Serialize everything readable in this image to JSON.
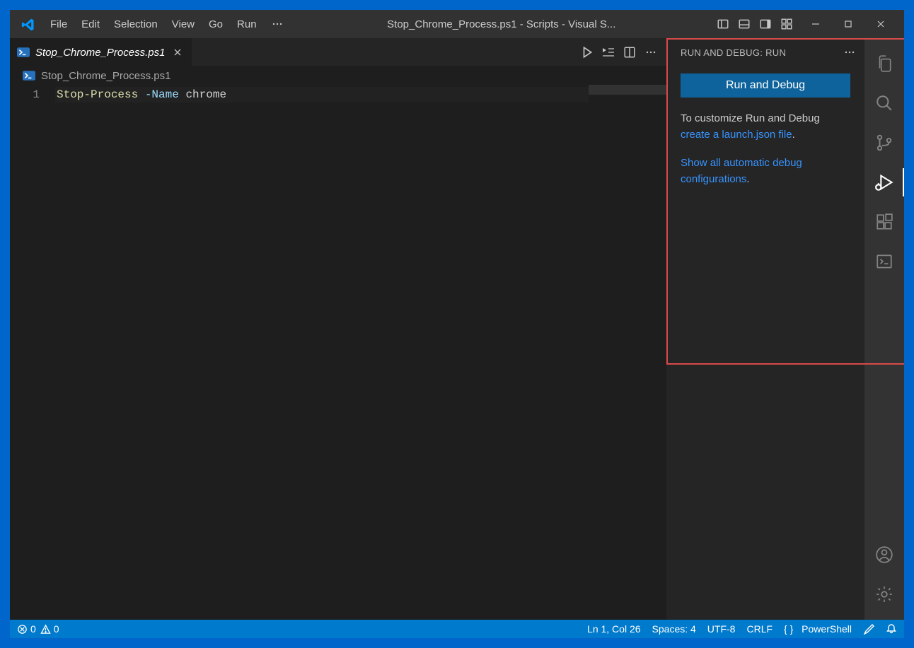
{
  "menu": {
    "items": [
      "File",
      "Edit",
      "Selection",
      "View",
      "Go",
      "Run"
    ]
  },
  "window": {
    "title": "Stop_Chrome_Process.ps1 - Scripts - Visual S..."
  },
  "tab": {
    "label": "Stop_Chrome_Process.ps1"
  },
  "breadcrumb": {
    "file": "Stop_Chrome_Process.ps1"
  },
  "editor": {
    "lineNumber": "1",
    "tokens": {
      "cmd": "Stop-Process",
      "param": "-Name",
      "arg": "chrome"
    }
  },
  "panel": {
    "title": "RUN AND DEBUG: RUN",
    "button": "Run and Debug",
    "text1a": "To customize Run and Debug ",
    "link1": "create a launch.json file",
    "text1b": ".",
    "link2": "Show all automatic debug configurations",
    "text2b": "."
  },
  "status": {
    "errors": "0",
    "warnings": "0",
    "lineCol": "Ln 1, Col 26",
    "spaces": "Spaces: 4",
    "encoding": "UTF-8",
    "eol": "CRLF",
    "lang": "PowerShell"
  }
}
